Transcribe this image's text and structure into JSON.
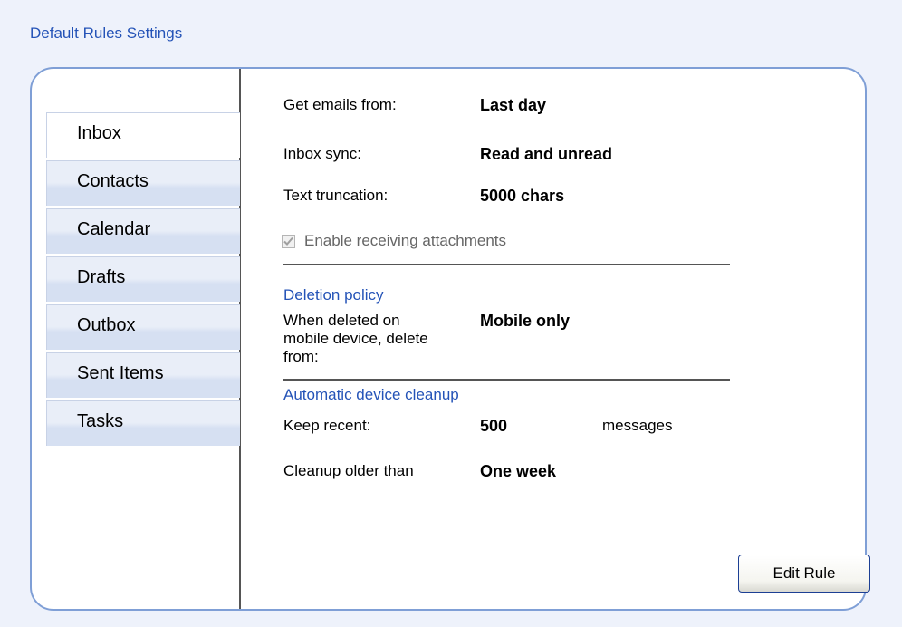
{
  "page_title": "Default Rules Settings",
  "tabs": [
    {
      "label": "Inbox",
      "active": true
    },
    {
      "label": "Contacts"
    },
    {
      "label": "Calendar"
    },
    {
      "label": "Drafts"
    },
    {
      "label": "Outbox"
    },
    {
      "label": "Sent Items"
    },
    {
      "label": "Tasks"
    }
  ],
  "settings": {
    "get_emails": {
      "label": "Get emails from:",
      "value": "Last day"
    },
    "inbox_sync": {
      "label": "Inbox sync:",
      "value": "Read and unread"
    },
    "text_truncation": {
      "label": "Text truncation:",
      "value": "5000 chars"
    },
    "attachments": {
      "label": "Enable receiving attachments",
      "checked": true
    }
  },
  "deletion_policy": {
    "title": "Deletion policy",
    "label_line1": "When deleted on",
    "label_line2": "mobile device, delete",
    "label_line3": "from:",
    "value": "Mobile only"
  },
  "cleanup": {
    "title": "Automatic device cleanup",
    "keep_recent": {
      "label": "Keep recent:",
      "value": "500",
      "unit": "messages"
    },
    "older_than": {
      "label": "Cleanup older than",
      "value": "One week"
    }
  },
  "edit_button": "Edit Rule",
  "colors": {
    "accent": "#2453b7",
    "panel_border": "#7f9fd6",
    "background": "#eef2fb"
  }
}
